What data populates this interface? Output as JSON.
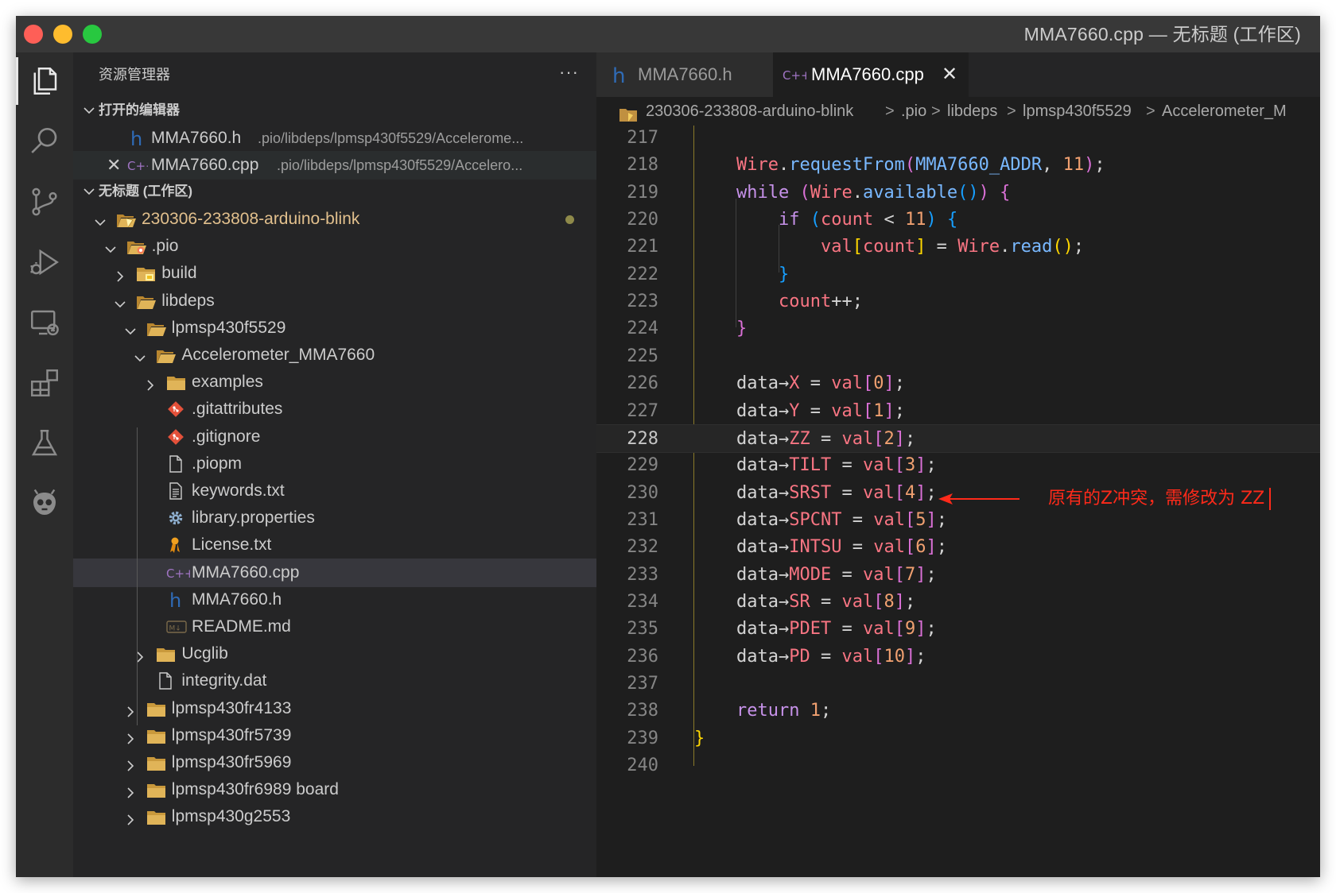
{
  "window": {
    "title": "MMA7660.cpp — 无标题 (工作区)"
  },
  "activity_bar": [
    {
      "name": "explorer-icon",
      "active": true
    },
    {
      "name": "search-icon"
    },
    {
      "name": "source-control-icon"
    },
    {
      "name": "run-debug-icon"
    },
    {
      "name": "remote-explorer-icon"
    },
    {
      "name": "extensions-icon"
    },
    {
      "name": "testing-icon"
    },
    {
      "name": "platformio-icon"
    }
  ],
  "sidebar": {
    "title": "资源管理器",
    "more": "···",
    "open_editors": {
      "label": "打开的编辑器",
      "items": [
        {
          "name": "MMA7660.h",
          "path": ".pio/libdeps/lpmsp430f5529/Accelerome...",
          "icon": "h"
        },
        {
          "name": "MMA7660.cpp",
          "path": ".pio/libdeps/lpmsp430f5529/Accelero...",
          "icon": "cpp",
          "close": "✕"
        }
      ]
    },
    "workspace": {
      "label": "无标题 (工作区)",
      "tree": [
        {
          "label": "230306-233808-arduino-blink",
          "depth": 0,
          "twisty": "open",
          "icon": "folder-project",
          "modified": true
        },
        {
          "label": ".pio",
          "depth": 1,
          "twisty": "open",
          "icon": "folder-pio"
        },
        {
          "label": "build",
          "depth": 2,
          "twisty": "closed",
          "icon": "folder-build"
        },
        {
          "label": "libdeps",
          "depth": 2,
          "twisty": "open",
          "icon": "folder-open"
        },
        {
          "label": "lpmsp430f5529",
          "depth": 3,
          "twisty": "open",
          "icon": "folder-open"
        },
        {
          "label": "Accelerometer_MMA7660",
          "depth": 4,
          "twisty": "open",
          "icon": "folder-open"
        },
        {
          "label": "examples",
          "depth": 5,
          "twisty": "closed",
          "icon": "folder"
        },
        {
          "label": ".gitattributes",
          "depth": 5,
          "icon": "git"
        },
        {
          "label": ".gitignore",
          "depth": 5,
          "icon": "git"
        },
        {
          "label": ".piopm",
          "depth": 5,
          "icon": "file"
        },
        {
          "label": "keywords.txt",
          "depth": 5,
          "icon": "text"
        },
        {
          "label": "library.properties",
          "depth": 5,
          "icon": "gear"
        },
        {
          "label": "License.txt",
          "depth": 5,
          "icon": "license"
        },
        {
          "label": "MMA7660.cpp",
          "depth": 5,
          "icon": "cpp",
          "selected": true
        },
        {
          "label": "MMA7660.h",
          "depth": 5,
          "icon": "h"
        },
        {
          "label": "README.md",
          "depth": 5,
          "icon": "md"
        },
        {
          "label": "Ucglib",
          "depth": 4,
          "twisty": "closed",
          "icon": "folder"
        },
        {
          "label": "integrity.dat",
          "depth": 4,
          "icon": "file"
        },
        {
          "label": "lpmsp430fr4133",
          "depth": 3,
          "twisty": "closed",
          "icon": "folder"
        },
        {
          "label": "lpmsp430fr5739",
          "depth": 3,
          "twisty": "closed",
          "icon": "folder"
        },
        {
          "label": "lpmsp430fr5969",
          "depth": 3,
          "twisty": "closed",
          "icon": "folder"
        },
        {
          "label": "lpmsp430fr6989 board",
          "depth": 3,
          "twisty": "closed",
          "icon": "folder"
        },
        {
          "label": "lpmsp430g2553",
          "depth": 3,
          "twisty": "closed",
          "icon": "folder"
        }
      ]
    }
  },
  "tabs": [
    {
      "label": "MMA7660.h",
      "icon": "h",
      "active": false
    },
    {
      "label": "MMA7660.cpp",
      "icon": "cpp",
      "active": true,
      "close": "✕"
    }
  ],
  "breadcrumb": [
    "230306-233808-arduino-blink",
    ".pio",
    "libdeps",
    "lpmsp430f5529",
    "Accelerometer_M"
  ],
  "breadcrumb_sep": ">",
  "code": {
    "current_line": 228,
    "lines": [
      {
        "n": "217",
        "tokens": []
      },
      {
        "n": "218",
        "tokens": [
          [
            "    ",
            "plain"
          ],
          [
            "Wire",
            "wire"
          ],
          [
            ".",
            "plain"
          ],
          [
            "requestFrom",
            "method"
          ],
          [
            "(",
            "br2"
          ],
          [
            "MMA7660_ADDR",
            "const"
          ],
          [
            ", ",
            "plain"
          ],
          [
            "11",
            "num"
          ],
          [
            ")",
            "br2"
          ],
          [
            ";",
            "plain"
          ]
        ]
      },
      {
        "n": "219",
        "tokens": [
          [
            "    ",
            "plain"
          ],
          [
            "while",
            "kw"
          ],
          [
            " ",
            "plain"
          ],
          [
            "(",
            "br2"
          ],
          [
            "Wire",
            "wire"
          ],
          [
            ".",
            "plain"
          ],
          [
            "available",
            "method"
          ],
          [
            "()",
            "br3"
          ],
          [
            ")",
            "br2"
          ],
          [
            " ",
            "plain"
          ],
          [
            "{",
            "br2"
          ]
        ]
      },
      {
        "n": "220",
        "tokens": [
          [
            "        ",
            "plain"
          ],
          [
            "if",
            "kw"
          ],
          [
            " ",
            "plain"
          ],
          [
            "(",
            "br3"
          ],
          [
            "count",
            "field"
          ],
          [
            " < ",
            "plain"
          ],
          [
            "11",
            "num"
          ],
          [
            ")",
            "br3"
          ],
          [
            " ",
            "plain"
          ],
          [
            "{",
            "br3"
          ]
        ]
      },
      {
        "n": "221",
        "tokens": [
          [
            "            ",
            "plain"
          ],
          [
            "val",
            "field"
          ],
          [
            "[",
            "br1"
          ],
          [
            "count",
            "field"
          ],
          [
            "]",
            "br1"
          ],
          [
            " = ",
            "plain"
          ],
          [
            "Wire",
            "wire"
          ],
          [
            ".",
            "plain"
          ],
          [
            "read",
            "method"
          ],
          [
            "()",
            "br1"
          ],
          [
            ";",
            "plain"
          ]
        ]
      },
      {
        "n": "222",
        "tokens": [
          [
            "        ",
            "plain"
          ],
          [
            "}",
            "br3"
          ]
        ]
      },
      {
        "n": "223",
        "tokens": [
          [
            "        ",
            "plain"
          ],
          [
            "count",
            "field"
          ],
          [
            "++",
            "plain"
          ],
          [
            ";",
            "plain"
          ]
        ]
      },
      {
        "n": "224",
        "tokens": [
          [
            "    ",
            "plain"
          ],
          [
            "}",
            "br2"
          ]
        ]
      },
      {
        "n": "225",
        "tokens": []
      },
      {
        "n": "226",
        "tokens": [
          [
            "    ",
            "plain"
          ],
          [
            "data",
            "plain"
          ],
          [
            "→",
            "plain"
          ],
          [
            "X",
            "field"
          ],
          [
            " = ",
            "plain"
          ],
          [
            "val",
            "field"
          ],
          [
            "[",
            "br2"
          ],
          [
            "0",
            "num"
          ],
          [
            "]",
            "br2"
          ],
          [
            ";",
            "plain"
          ]
        ]
      },
      {
        "n": "227",
        "tokens": [
          [
            "    ",
            "plain"
          ],
          [
            "data",
            "plain"
          ],
          [
            "→",
            "plain"
          ],
          [
            "Y",
            "field"
          ],
          [
            " = ",
            "plain"
          ],
          [
            "val",
            "field"
          ],
          [
            "[",
            "br2"
          ],
          [
            "1",
            "num"
          ],
          [
            "]",
            "br2"
          ],
          [
            ";",
            "plain"
          ]
        ]
      },
      {
        "n": "228",
        "tokens": [
          [
            "    ",
            "plain"
          ],
          [
            "data",
            "plain"
          ],
          [
            "→",
            "plain"
          ],
          [
            "ZZ",
            "field"
          ],
          [
            " = ",
            "plain"
          ],
          [
            "val",
            "field"
          ],
          [
            "[",
            "br2"
          ],
          [
            "2",
            "num"
          ],
          [
            "]",
            "br2"
          ],
          [
            ";",
            "plain"
          ]
        ]
      },
      {
        "n": "229",
        "tokens": [
          [
            "    ",
            "plain"
          ],
          [
            "data",
            "plain"
          ],
          [
            "→",
            "plain"
          ],
          [
            "TILT",
            "field"
          ],
          [
            " = ",
            "plain"
          ],
          [
            "val",
            "field"
          ],
          [
            "[",
            "br2"
          ],
          [
            "3",
            "num"
          ],
          [
            "]",
            "br2"
          ],
          [
            ";",
            "plain"
          ]
        ]
      },
      {
        "n": "230",
        "tokens": [
          [
            "    ",
            "plain"
          ],
          [
            "data",
            "plain"
          ],
          [
            "→",
            "plain"
          ],
          [
            "SRST",
            "field"
          ],
          [
            " = ",
            "plain"
          ],
          [
            "val",
            "field"
          ],
          [
            "[",
            "br2"
          ],
          [
            "4",
            "num"
          ],
          [
            "]",
            "br2"
          ],
          [
            ";",
            "plain"
          ]
        ]
      },
      {
        "n": "231",
        "tokens": [
          [
            "    ",
            "plain"
          ],
          [
            "data",
            "plain"
          ],
          [
            "→",
            "plain"
          ],
          [
            "SPCNT",
            "field"
          ],
          [
            " = ",
            "plain"
          ],
          [
            "val",
            "field"
          ],
          [
            "[",
            "br2"
          ],
          [
            "5",
            "num"
          ],
          [
            "]",
            "br2"
          ],
          [
            ";",
            "plain"
          ]
        ]
      },
      {
        "n": "232",
        "tokens": [
          [
            "    ",
            "plain"
          ],
          [
            "data",
            "plain"
          ],
          [
            "→",
            "plain"
          ],
          [
            "INTSU",
            "field"
          ],
          [
            " = ",
            "plain"
          ],
          [
            "val",
            "field"
          ],
          [
            "[",
            "br2"
          ],
          [
            "6",
            "num"
          ],
          [
            "]",
            "br2"
          ],
          [
            ";",
            "plain"
          ]
        ]
      },
      {
        "n": "233",
        "tokens": [
          [
            "    ",
            "plain"
          ],
          [
            "data",
            "plain"
          ],
          [
            "→",
            "plain"
          ],
          [
            "MODE",
            "field"
          ],
          [
            " = ",
            "plain"
          ],
          [
            "val",
            "field"
          ],
          [
            "[",
            "br2"
          ],
          [
            "7",
            "num"
          ],
          [
            "]",
            "br2"
          ],
          [
            ";",
            "plain"
          ]
        ]
      },
      {
        "n": "234",
        "tokens": [
          [
            "    ",
            "plain"
          ],
          [
            "data",
            "plain"
          ],
          [
            "→",
            "plain"
          ],
          [
            "SR",
            "field"
          ],
          [
            " = ",
            "plain"
          ],
          [
            "val",
            "field"
          ],
          [
            "[",
            "br2"
          ],
          [
            "8",
            "num"
          ],
          [
            "]",
            "br2"
          ],
          [
            ";",
            "plain"
          ]
        ]
      },
      {
        "n": "235",
        "tokens": [
          [
            "    ",
            "plain"
          ],
          [
            "data",
            "plain"
          ],
          [
            "→",
            "plain"
          ],
          [
            "PDET",
            "field"
          ],
          [
            " = ",
            "plain"
          ],
          [
            "val",
            "field"
          ],
          [
            "[",
            "br2"
          ],
          [
            "9",
            "num"
          ],
          [
            "]",
            "br2"
          ],
          [
            ";",
            "plain"
          ]
        ]
      },
      {
        "n": "236",
        "tokens": [
          [
            "    ",
            "plain"
          ],
          [
            "data",
            "plain"
          ],
          [
            "→",
            "plain"
          ],
          [
            "PD",
            "field"
          ],
          [
            " = ",
            "plain"
          ],
          [
            "val",
            "field"
          ],
          [
            "[",
            "br2"
          ],
          [
            "10",
            "num"
          ],
          [
            "]",
            "br2"
          ],
          [
            ";",
            "plain"
          ]
        ]
      },
      {
        "n": "237",
        "tokens": []
      },
      {
        "n": "238",
        "tokens": [
          [
            "    ",
            "plain"
          ],
          [
            "return",
            "kw"
          ],
          [
            " ",
            "plain"
          ],
          [
            "1",
            "num"
          ],
          [
            ";",
            "plain"
          ]
        ]
      },
      {
        "n": "239",
        "tokens": [
          [
            "}",
            "br1"
          ]
        ]
      },
      {
        "n": "240",
        "tokens": []
      }
    ]
  },
  "annotation": {
    "text": "原有的Z冲突，需修改为 ZZ",
    "color": "#ff2a1a"
  },
  "colors": {
    "editor_bg": "#1e1e1e",
    "sidebar_bg": "#252526",
    "activity_bg": "#2c2c2c",
    "titlebar_bg": "#383838",
    "selection": "#37373d",
    "project_folder": "#e2c08d"
  }
}
